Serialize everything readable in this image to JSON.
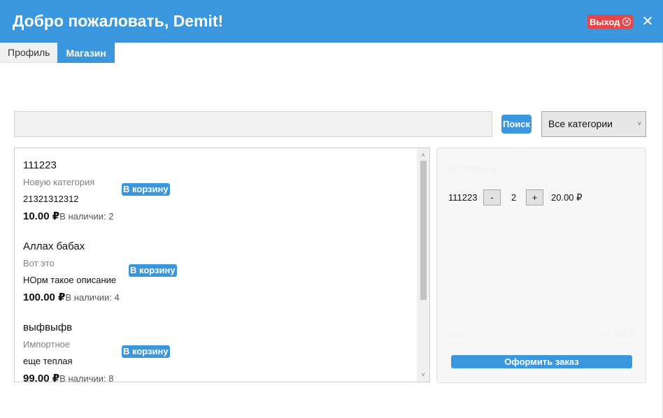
{
  "header": {
    "title": "Добро пожаловать, Demit!",
    "logout_label": "Выход",
    "close_glyph": "✕",
    "bg_color": "#3b97dd"
  },
  "tabs": [
    {
      "label": "Профиль",
      "active": false
    },
    {
      "label": "Магазин",
      "active": true
    }
  ],
  "search": {
    "value": "",
    "placeholder": "",
    "button_label": "Поиск"
  },
  "category_select": {
    "selected": "Все категории"
  },
  "products": [
    {
      "name": "111223",
      "category": "Новую категория",
      "description": "21321312312",
      "price": "10.00 ₽",
      "stock": "В наличии: 2",
      "add_label": "В корзину"
    },
    {
      "name": "Аллах бабах",
      "category": "Вот это",
      "description": "НОрм такое описание",
      "price": "100.00 ₽",
      "stock": "В наличии: 4",
      "add_label": "В корзину"
    },
    {
      "name": "выфвыфв",
      "category": "Импортное",
      "description": "еще теплая",
      "price": "99.00 ₽",
      "stock": "В наличии: 8",
      "add_label": "В корзину"
    }
  ],
  "cart": {
    "title": "Корзина",
    "items": [
      {
        "name": "111223",
        "minus": "-",
        "qty": "2",
        "plus": "+",
        "price": "20.00 ₽"
      }
    ],
    "total_label": "Итого:",
    "total_value": "20.00 ₽",
    "checkout_label": "Оформить заказ"
  },
  "icons": {
    "logout": "circle-x-icon",
    "close": "close-icon",
    "select": "chevron-down-icon",
    "scroll_up": "chevron-up-icon",
    "scroll_down": "chevron-down-icon"
  }
}
